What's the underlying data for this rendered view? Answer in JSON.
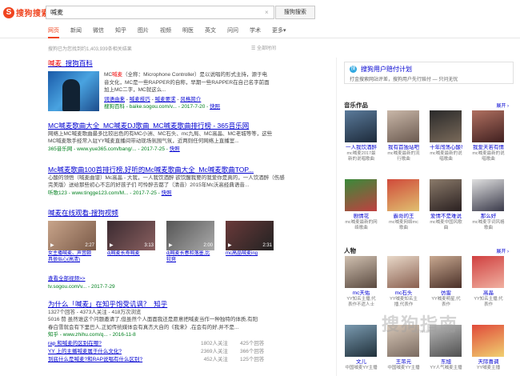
{
  "header": {
    "logo_mark": "S",
    "logo_text": "搜狗搜索",
    "query": "喊麦",
    "clear": "×",
    "search_button": "搜狗搜索",
    "tabs": [
      {
        "label": "网页",
        "active": true
      },
      {
        "label": "新闻"
      },
      {
        "label": "微信"
      },
      {
        "label": "知乎"
      },
      {
        "label": "图片"
      },
      {
        "label": "视频"
      },
      {
        "label": "明医"
      },
      {
        "label": "英文"
      },
      {
        "label": "问问"
      },
      {
        "label": "学术"
      },
      {
        "label": "更多"
      }
    ],
    "more_arrow": "▾"
  },
  "meta": {
    "result_count": "搜狗已为您找到约1,403,939条相关结果",
    "time_filter": "全部时间"
  },
  "r1": {
    "title_red": "喊麦",
    "title_rest": "_搜狗百科",
    "desc_l1a": "MC",
    "desc_l1b": "喊麦",
    "desc_l1c": "（全称：Microphone Controller）是以说唱的形式主持，源于电",
    "desc_l2": "音文化，MC是一些RAPPER的自称，早期一些RAPPER在自己名字前面",
    "desc_l3": "加上MC二字，MC就这么...",
    "links": [
      "词语由来",
      "喊麦技巧",
      "喊麦要求",
      "风格简介"
    ],
    "site": "搜狗百科",
    "url": "baike.sogou.com/v...",
    "date": "2017-7-20",
    "snapshot": "快照"
  },
  "r2": {
    "title": "MC喊麦歌曲大全_MC喊麦DJ歌曲_MC喊麦歌曲排行榜 - 365音乐网",
    "desc1": "网络上MC喊麦歌曲最多比较出色的有MC小洲、MC石头、mc九局、MC高晶、MC老城等等，这些",
    "desc2": "MC喊麦歌手经常入驻YY喊麦直播间带动现场氛围气氛，近两则任何网络上直播室...",
    "site": "365音乐网",
    "url": "www.yue365.com/bang/...",
    "date": "2017-7-25",
    "snapshot": "快照"
  },
  "r3": {
    "title": "Mc喊麦歌曲100首排行榜,好听的Mc喊麦歌曲大全_Mc喊麦歌曲TOP...",
    "desc1": "心酸的领悟（喊麦曲谱）Mc高晶 - 大我，一人我饮酒醉 欲饮醒我要的我爱你是真的，一人饮酒醉（伤感",
    "desc2": "完美版）送给那些初心不忘的好孩子们 可怜醉去都了（清音）2015年Mc沃高经典语音...",
    "site": "听歌123",
    "url": "www.tingge123.com/M...",
    "date": "2017-7-25",
    "snapshot": "快照"
  },
  "r4": {
    "title": "喊麦在线观看-搜狗视频",
    "videos": [
      {
        "title": "女主播喊麦、声音颇",
        "title2": "具很似心(高清)",
        "dur": "2:27"
      },
      {
        "title": "dj喊麦长寿喊麦",
        "title2": "",
        "dur": "3:13"
      },
      {
        "title": "dj喊麦长春和落墨,比",
        "title2": "较爽",
        "dur": "2:00"
      },
      {
        "title": "mc高晶喊麦ing",
        "title2": "",
        "dur": "2:31"
      }
    ],
    "more": "查看全部视频>>",
    "url": "tv.sogou.com/v...",
    "date": "2017-7-29"
  },
  "r5": {
    "title": "为什么「喊麦」在知乎饱受讥讽？_知乎",
    "stats": "1327个回答 - 4373人关注 - 418万次浏览",
    "desc1": "5016 赞 虽然谁这个问题邀请了,但虽然个人面面我还是愿意把喊麦当作一种独特的体质,有阳",
    "desc2": "春白雪就会有下里巴人,正如传统媒体会有真杰大自的《我来》,在会有的好,并不是...",
    "site": "知乎",
    "url": "www.zhihu.com/q...",
    "date": "2016-11-8",
    "questions": [
      {
        "q": "rap 和喊麦的区别在哪?",
        "a": "1802人关注",
        "b": "425个回答"
      },
      {
        "q": "YY 上的主播喊麦属于什么文化?",
        "a": "2369人关注",
        "b": "366个回答"
      },
      {
        "q": "到底什么是喊麦?和RAP说唱有什么区别?",
        "a": "452人关注",
        "b": "125个回答"
      }
    ]
  },
  "sidebar": {
    "ad": {
      "icon": "搜",
      "title": "搜狗用户赔付计划",
      "desc": "打金搜索网站评差，搜狗用户先行赔付 — 只问无忧"
    },
    "music": {
      "title": "音乐作品",
      "expand": "展开",
      "items": [
        {
          "name": "一人我饮酒醉",
          "desc": "mc喊麦2017最新的说唱歌曲"
        },
        {
          "name": "我有首独站吧",
          "desc": "mc喊麦最新的流行歌曲"
        },
        {
          "name": "十年闯荡心酸事",
          "desc": "mc喊麦最新的说唱歌曲"
        },
        {
          "name": "我爱天若有情",
          "desc": "mc喊麦最新的说唱歌曲"
        },
        {
          "name": "剧情花",
          "desc": "mc喊麦最新的网络歌曲"
        },
        {
          "name": "霸哥的王",
          "desc": "mc喊麦网络mc歌曲"
        },
        {
          "name": "爱情不是难说",
          "desc": "mc喊麦中国风歌曲"
        },
        {
          "name": "那么好",
          "desc": "mc喊麦字词风格歌曲"
        }
      ]
    },
    "people": {
      "title": "人物",
      "expand": "展开",
      "items": [
        {
          "name": "mc天佑",
          "desc": "YY知名主播,代表作不遗人士"
        },
        {
          "name": "mc石头",
          "desc": "YY喊麦知名主播,代表作"
        },
        {
          "name": "仿雷",
          "desc": "YY喊麦明星,代表作"
        },
        {
          "name": "高晶",
          "desc": "YY知名主播,代表作"
        },
        {
          "name": "文儿",
          "desc": "中国喊麦YY主播"
        },
        {
          "name": "王吊元",
          "desc": "中国喊麦YY主播"
        },
        {
          "name": "东旭",
          "desc": "YY人气喊麦主播"
        },
        {
          "name": "天际喜调",
          "desc": "YY喊麦主播"
        }
      ]
    }
  },
  "watermark": {
    "text": "搜狗指南",
    "sub": "zhinan.sogou.com"
  }
}
